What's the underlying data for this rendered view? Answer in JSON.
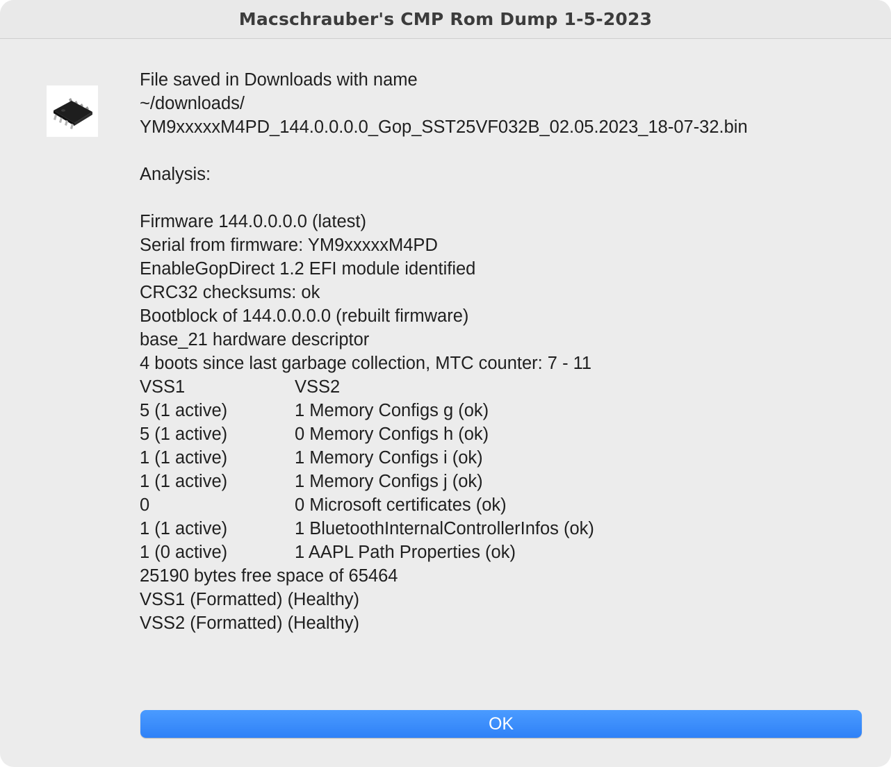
{
  "window": {
    "title": "Macschrauber's CMP Rom Dump 1-5-2023",
    "icon": "eeprom-chip-icon"
  },
  "message": {
    "saved_lines": [
      "File saved in Downloads with name",
      "~/downloads/",
      "YM9xxxxxM4PD_144.0.0.0.0_Gop_SST25VF032B_02.05.2023_18-07-32.bin"
    ],
    "analysis_heading": "Analysis:",
    "analysis_lines": [
      "Firmware 144.0.0.0.0 (latest)",
      "Serial from firmware: YM9xxxxxM4PD",
      "EnableGopDirect 1.2 EFI module identified",
      "CRC32 checksums: ok",
      "Bootblock of 144.0.0.0.0 (rebuilt firmware)",
      "base_21 hardware descriptor",
      "4 boots since last garbage collection, MTC counter: 7 - 11"
    ],
    "vss_header": [
      "VSS1",
      "VSS2"
    ],
    "vss_rows": [
      [
        "5 (1 active)",
        "1 Memory Configs g (ok)"
      ],
      [
        "5 (1 active)",
        "0 Memory Configs h (ok)"
      ],
      [
        "1 (1 active)",
        "1 Memory Configs i (ok)"
      ],
      [
        "1 (1 active)",
        "1 Memory Configs j (ok)"
      ],
      [
        "0",
        "0 Microsoft certificates (ok)"
      ],
      [
        "1 (1 active)",
        "1 BluetoothInternalControllerInfos (ok)"
      ],
      [
        "1 (0 active)",
        "1 AAPL Path Properties (ok)"
      ]
    ],
    "footer_lines": [
      "25190 bytes free space of 65464",
      "VSS1 (Formatted) (Healthy)",
      "VSS2 (Formatted) (Healthy)"
    ]
  },
  "buttons": {
    "ok_label": "OK"
  },
  "colors": {
    "window_bg": "#ececec",
    "button_blue": "#3a8bfb",
    "text": "#1f1f1f"
  }
}
